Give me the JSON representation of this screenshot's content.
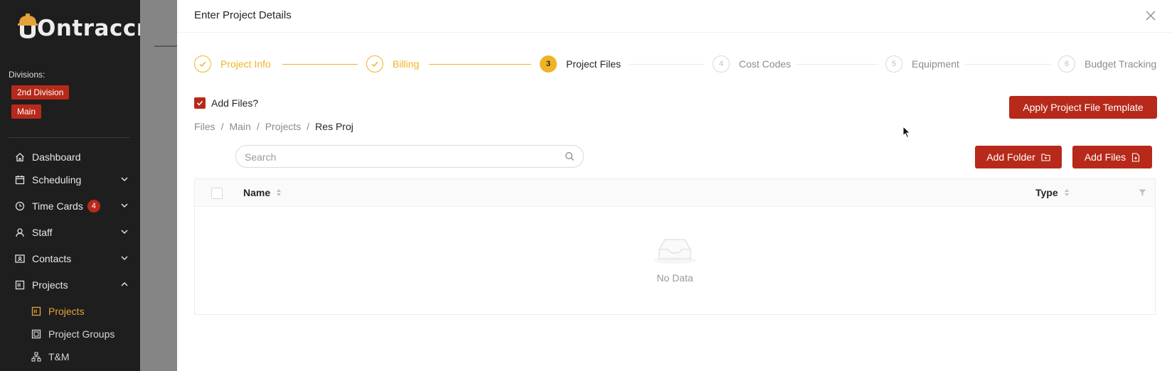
{
  "sidebar": {
    "logo_text": "Ontraccr",
    "divisions_label": "Divisions:",
    "divisions": [
      "2nd Division",
      "Main"
    ],
    "nav": [
      {
        "label": "Dashboard",
        "icon": "home-icon"
      },
      {
        "label": "Scheduling",
        "icon": "calendar-icon",
        "expandable": true
      },
      {
        "label": "Time Cards",
        "icon": "clock-icon",
        "badge": "4",
        "expandable": true
      },
      {
        "label": "Staff",
        "icon": "user-icon",
        "expandable": true
      },
      {
        "label": "Contacts",
        "icon": "contacts-card-icon",
        "expandable": true
      },
      {
        "label": "Projects",
        "icon": "projects-icon",
        "expanded": true
      }
    ],
    "sub_nav": [
      {
        "label": "Projects",
        "icon": "projects-icon",
        "active": true
      },
      {
        "label": "Project Groups",
        "icon": "project-groups-icon"
      },
      {
        "label": "T&M",
        "icon": "hierarchy-icon"
      }
    ]
  },
  "drawer": {
    "title": "Enter Project Details",
    "steps": [
      {
        "label": "Project Info",
        "status": "done"
      },
      {
        "label": "Billing",
        "status": "done"
      },
      {
        "label": "Project Files",
        "number": "3",
        "status": "current"
      },
      {
        "label": "Cost Codes",
        "number": "4",
        "status": "todo"
      },
      {
        "label": "Equipment",
        "number": "5",
        "status": "todo"
      },
      {
        "label": "Budget Tracking",
        "number": "6",
        "status": "todo"
      }
    ],
    "add_files_checkbox": {
      "label": "Add Files?",
      "checked": true
    },
    "apply_template_button": "Apply Project File Template",
    "breadcrumb": [
      "Files",
      "Main",
      "Projects",
      "Res Proj"
    ],
    "search": {
      "placeholder": "Search",
      "value": ""
    },
    "add_folder_button": "Add Folder",
    "add_files_button": "Add Files",
    "table": {
      "columns": [
        "Name",
        "Type"
      ],
      "empty_text": "No Data"
    }
  },
  "colors": {
    "accent_red": "#b7291a",
    "step_yellow": "#f0b323",
    "sidebar_bg": "#1e1e1e"
  }
}
